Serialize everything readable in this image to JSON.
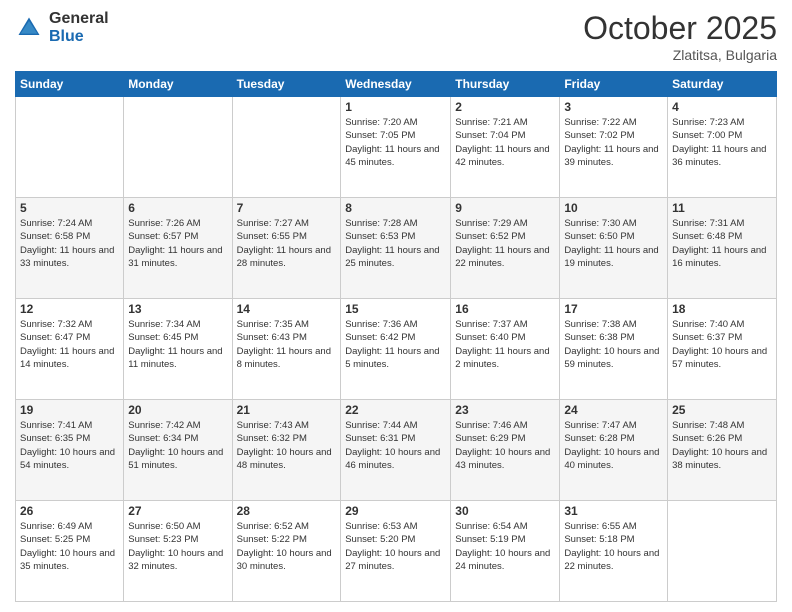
{
  "header": {
    "logo_general": "General",
    "logo_blue": "Blue",
    "month_title": "October 2025",
    "subtitle": "Zlatitsa, Bulgaria"
  },
  "days_of_week": [
    "Sunday",
    "Monday",
    "Tuesday",
    "Wednesday",
    "Thursday",
    "Friday",
    "Saturday"
  ],
  "weeks": [
    [
      {
        "day": "",
        "info": ""
      },
      {
        "day": "",
        "info": ""
      },
      {
        "day": "",
        "info": ""
      },
      {
        "day": "1",
        "info": "Sunrise: 7:20 AM\nSunset: 7:05 PM\nDaylight: 11 hours and 45 minutes."
      },
      {
        "day": "2",
        "info": "Sunrise: 7:21 AM\nSunset: 7:04 PM\nDaylight: 11 hours and 42 minutes."
      },
      {
        "day": "3",
        "info": "Sunrise: 7:22 AM\nSunset: 7:02 PM\nDaylight: 11 hours and 39 minutes."
      },
      {
        "day": "4",
        "info": "Sunrise: 7:23 AM\nSunset: 7:00 PM\nDaylight: 11 hours and 36 minutes."
      }
    ],
    [
      {
        "day": "5",
        "info": "Sunrise: 7:24 AM\nSunset: 6:58 PM\nDaylight: 11 hours and 33 minutes."
      },
      {
        "day": "6",
        "info": "Sunrise: 7:26 AM\nSunset: 6:57 PM\nDaylight: 11 hours and 31 minutes."
      },
      {
        "day": "7",
        "info": "Sunrise: 7:27 AM\nSunset: 6:55 PM\nDaylight: 11 hours and 28 minutes."
      },
      {
        "day": "8",
        "info": "Sunrise: 7:28 AM\nSunset: 6:53 PM\nDaylight: 11 hours and 25 minutes."
      },
      {
        "day": "9",
        "info": "Sunrise: 7:29 AM\nSunset: 6:52 PM\nDaylight: 11 hours and 22 minutes."
      },
      {
        "day": "10",
        "info": "Sunrise: 7:30 AM\nSunset: 6:50 PM\nDaylight: 11 hours and 19 minutes."
      },
      {
        "day": "11",
        "info": "Sunrise: 7:31 AM\nSunset: 6:48 PM\nDaylight: 11 hours and 16 minutes."
      }
    ],
    [
      {
        "day": "12",
        "info": "Sunrise: 7:32 AM\nSunset: 6:47 PM\nDaylight: 11 hours and 14 minutes."
      },
      {
        "day": "13",
        "info": "Sunrise: 7:34 AM\nSunset: 6:45 PM\nDaylight: 11 hours and 11 minutes."
      },
      {
        "day": "14",
        "info": "Sunrise: 7:35 AM\nSunset: 6:43 PM\nDaylight: 11 hours and 8 minutes."
      },
      {
        "day": "15",
        "info": "Sunrise: 7:36 AM\nSunset: 6:42 PM\nDaylight: 11 hours and 5 minutes."
      },
      {
        "day": "16",
        "info": "Sunrise: 7:37 AM\nSunset: 6:40 PM\nDaylight: 11 hours and 2 minutes."
      },
      {
        "day": "17",
        "info": "Sunrise: 7:38 AM\nSunset: 6:38 PM\nDaylight: 10 hours and 59 minutes."
      },
      {
        "day": "18",
        "info": "Sunrise: 7:40 AM\nSunset: 6:37 PM\nDaylight: 10 hours and 57 minutes."
      }
    ],
    [
      {
        "day": "19",
        "info": "Sunrise: 7:41 AM\nSunset: 6:35 PM\nDaylight: 10 hours and 54 minutes."
      },
      {
        "day": "20",
        "info": "Sunrise: 7:42 AM\nSunset: 6:34 PM\nDaylight: 10 hours and 51 minutes."
      },
      {
        "day": "21",
        "info": "Sunrise: 7:43 AM\nSunset: 6:32 PM\nDaylight: 10 hours and 48 minutes."
      },
      {
        "day": "22",
        "info": "Sunrise: 7:44 AM\nSunset: 6:31 PM\nDaylight: 10 hours and 46 minutes."
      },
      {
        "day": "23",
        "info": "Sunrise: 7:46 AM\nSunset: 6:29 PM\nDaylight: 10 hours and 43 minutes."
      },
      {
        "day": "24",
        "info": "Sunrise: 7:47 AM\nSunset: 6:28 PM\nDaylight: 10 hours and 40 minutes."
      },
      {
        "day": "25",
        "info": "Sunrise: 7:48 AM\nSunset: 6:26 PM\nDaylight: 10 hours and 38 minutes."
      }
    ],
    [
      {
        "day": "26",
        "info": "Sunrise: 6:49 AM\nSunset: 5:25 PM\nDaylight: 10 hours and 35 minutes."
      },
      {
        "day": "27",
        "info": "Sunrise: 6:50 AM\nSunset: 5:23 PM\nDaylight: 10 hours and 32 minutes."
      },
      {
        "day": "28",
        "info": "Sunrise: 6:52 AM\nSunset: 5:22 PM\nDaylight: 10 hours and 30 minutes."
      },
      {
        "day": "29",
        "info": "Sunrise: 6:53 AM\nSunset: 5:20 PM\nDaylight: 10 hours and 27 minutes."
      },
      {
        "day": "30",
        "info": "Sunrise: 6:54 AM\nSunset: 5:19 PM\nDaylight: 10 hours and 24 minutes."
      },
      {
        "day": "31",
        "info": "Sunrise: 6:55 AM\nSunset: 5:18 PM\nDaylight: 10 hours and 22 minutes."
      },
      {
        "day": "",
        "info": ""
      }
    ]
  ]
}
